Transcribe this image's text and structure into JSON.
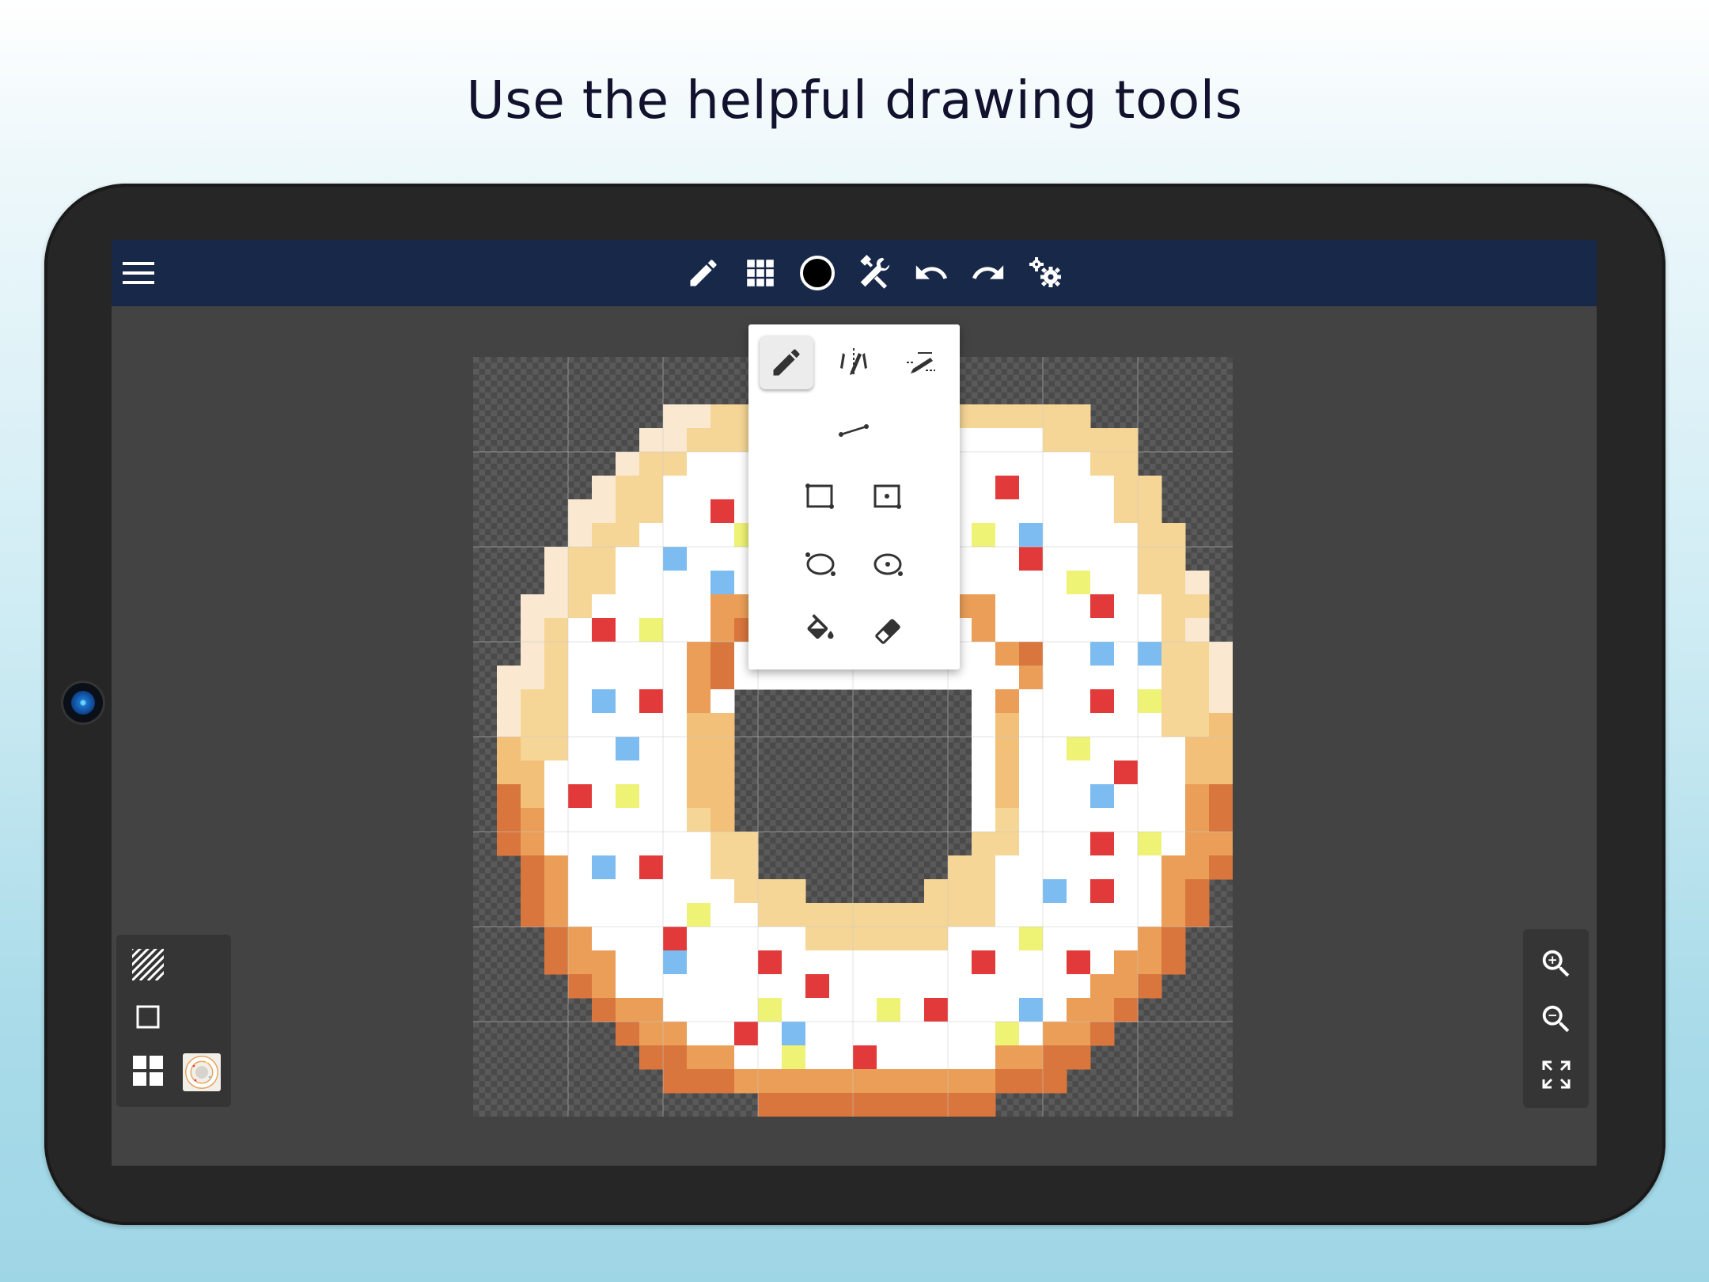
{
  "headline": "Use the helpful drawing tools",
  "icons": {
    "menu": "hamburger-menu-icon",
    "pencil": "pencil-icon",
    "grid": "grid-icon",
    "color": "color-circle-icon",
    "tools": "tools-icon",
    "undo": "undo-icon",
    "redo": "redo-icon",
    "settings": "settings-gears-icon"
  },
  "tool_popup": {
    "tools": [
      "pencil",
      "symmetric-pencil",
      "dither-pencil",
      "line",
      "rectangle",
      "filled-rectangle",
      "ellipse",
      "filled-ellipse",
      "fill-bucket",
      "eraser"
    ],
    "selected": "pencil"
  },
  "layer_panel": {
    "items": [
      "transparency-toggle-icon",
      "frame-toggle-icon",
      "layers-grid-icon",
      "donut-thumbnail"
    ]
  },
  "zoom_panel": {
    "items": [
      "zoom-in-icon",
      "zoom-out-icon",
      "fit-screen-icon"
    ]
  },
  "canvas": {
    "size": 32,
    "palette": {
      "W": "#ffffff",
      "a": "#fbe8d1",
      "b": "#f6d696",
      "c": "#f3c079",
      "d": "#ea9e57",
      "e": "#d9763d",
      "R": "#e23a3a",
      "Y": "#eef275",
      "B": "#7dbcf0"
    },
    "pixels": [
      "................................",
      "................................",
      "........aabbbbbbbbbbbbbbbb......",
      ".......aabbbWWWWWWWWWWWWbbbb....",
      "......abbWWWWWWWWWWWWWWWWWbb....",
      ".....abbWWWWWWWWWWWWWWRWWWWbb...",
      "....aabbWWRWWWWWWWWWWWWWWWWbb...",
      "....abbWWWWYWWWWWWWWWYWBWWWWbb..",
      "...abbWWBWWWWWWWWWWWWWWRWWWWbb..",
      "...abbWWWWBWWWWWWWWWWWWWWYWWbba.",
      "..aabWWWWWddWWWWWWWWddWWWWRWWbb.",
      "..abWRWYWWdeWWWWWWWWWdWWWWWWWba.",
      "..abWWWWWdeWWWWWWWWWWWdeWWBWBbba",
      ".aabWWWWWdeWWWWWWWWWWWWdWWWWWbba",
      ".abbWBWRWdW..........WdWWWRWYbba",
      ".abbWWWWWcc..........WcWWWWWWbbc",
      ".cbbWWBWWcc..........WcWWYWWWWcc",
      ".ccWWWWWWcc..........WcWWWWRWWcc",
      ".ecWRWYWWcc..........WcWWWBWWWde",
      ".edWWWWWWbc..........WbWWWWWWWde",
      ".edWWWWWWWbb.........bbWWWRWYWdd",
      "..edWBWRWWbb........bbWWWWWWWdde",
      "..edWWWWWWWbbb.....bbbWWBWRWWde.",
      "..edWWWWWYWWbbbbbbbbbbWWWWWWWde.",
      "...edWWWRWWWWWbbbbbbWWWYWWWWde..",
      "...eddWWBWWWRWWWWWWWWRWWWRWdde..",
      "....edWWWWWWWWRWWWWWWWWWWWdde...",
      ".....eddWWWWYWWWWYWRWWWBWdde....",
      "......eddWWRWBWWWWWWWWYWdde.....",
      ".......eeddWWYWWRWWWWWddee......",
      "........eeedddddddddddeee.......",
      "............eeeeeeeeee.........."
    ]
  }
}
